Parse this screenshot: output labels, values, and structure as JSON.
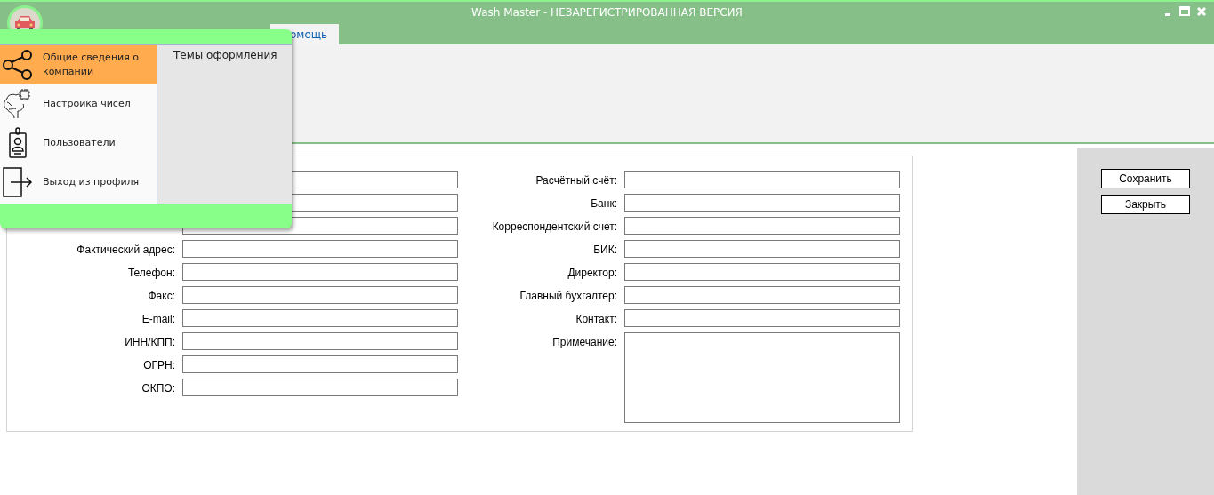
{
  "window": {
    "title": "Wash Master - НЕЗАРЕГИСТРИРОВАННАЯ ВЕРСИЯ"
  },
  "tabs": [
    {
      "label": "омощь",
      "selected": true
    }
  ],
  "app_menu": {
    "items": [
      {
        "label": "Общие сведения о компании",
        "kind": "share",
        "selected": true
      },
      {
        "label": "Настройка чисел",
        "kind": "brain",
        "selected": false
      },
      {
        "label": "Пользователи",
        "kind": "badge",
        "selected": false
      },
      {
        "label": "Выход из профиля",
        "kind": "exit",
        "selected": false
      }
    ],
    "side_items": [
      "Темы оформления"
    ]
  },
  "form": {
    "left": [
      {
        "kind": "field"
      },
      {
        "kind": "field"
      },
      {
        "kind": "field"
      },
      {
        "kind": "field",
        "label": "Фактический адрес:"
      },
      {
        "kind": "field",
        "label": "Телефон:"
      },
      {
        "kind": "field",
        "label": "Факс:"
      },
      {
        "kind": "field",
        "label": "E-mail:"
      },
      {
        "kind": "field",
        "label": "ИНН/КПП:"
      },
      {
        "kind": "field",
        "label": "ОГРН:"
      },
      {
        "kind": "field",
        "label": "ОКПО:"
      }
    ],
    "right": [
      {
        "kind": "field",
        "label": "Расчётный счёт:"
      },
      {
        "kind": "field",
        "label": "Банк:"
      },
      {
        "kind": "field",
        "label": "Корреспондентский счет:"
      },
      {
        "kind": "field",
        "label": "БИК:"
      },
      {
        "kind": "field",
        "label": "Директор:"
      },
      {
        "kind": "field",
        "label": "Главный бухгалтер:"
      },
      {
        "kind": "field",
        "label": "Контакт:"
      },
      {
        "kind": "textarea",
        "label": "Примечание:"
      }
    ]
  },
  "buttons": [
    "Сохранить",
    "Закрыть"
  ]
}
